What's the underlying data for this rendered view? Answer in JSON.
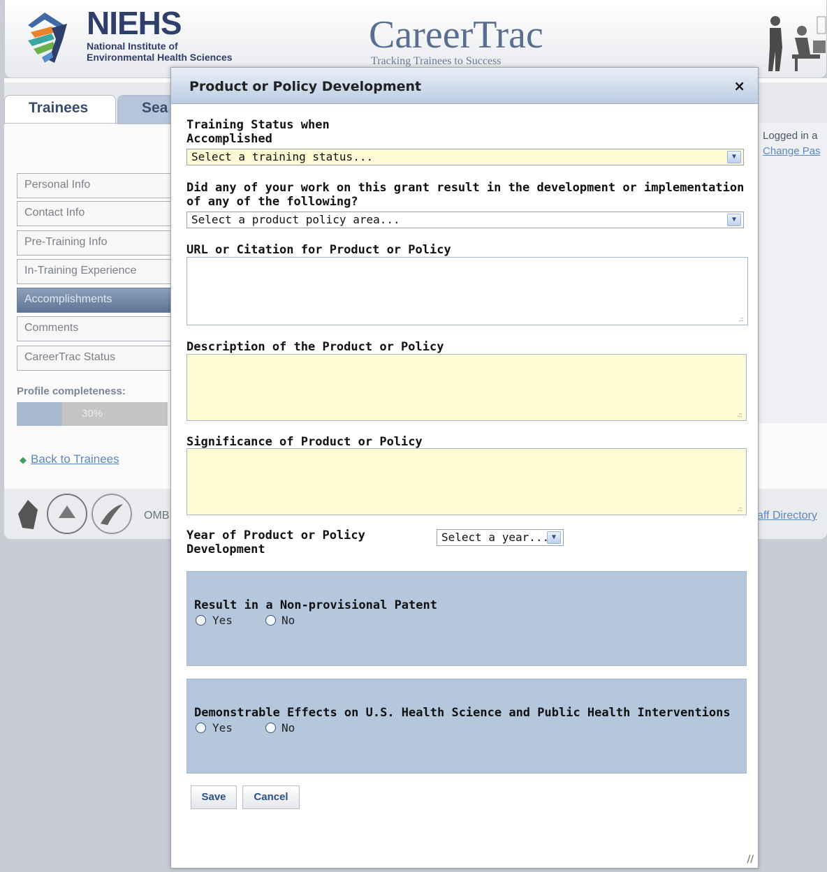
{
  "header": {
    "org_abbrev": "NIEHS",
    "org_line1": "National Institute of",
    "org_line2": "Environmental Health Sciences",
    "app_title": "CareerTrac",
    "app_tagline": "Tracking Trainees to Success"
  },
  "tabs": [
    {
      "label": "Trainees",
      "active": true
    },
    {
      "label": "Sea",
      "active": false
    }
  ],
  "sidebar": {
    "items": [
      {
        "label": "Personal Info",
        "active": false
      },
      {
        "label": "Contact Info",
        "active": false
      },
      {
        "label": "Pre-Training Info",
        "active": false
      },
      {
        "label": "In-Training Experience",
        "active": false
      },
      {
        "label": "Accomplishments",
        "active": true
      },
      {
        "label": "Comments",
        "active": false
      },
      {
        "label": "CareerTrac Status",
        "active": false
      }
    ],
    "profile_label": "Profile completeness:",
    "profile_percent": 30,
    "profile_text": "30%",
    "back_link": "Back to Trainees"
  },
  "user_panel": {
    "logged_in": "Logged in a",
    "change_password": "Change Pas"
  },
  "footer": {
    "omb": "OMB",
    "staff_directory": "aff Directory"
  },
  "dialog": {
    "title": "Product or Policy Development",
    "close_glyph": "×",
    "training_status": {
      "label_line1": "Training Status when",
      "label_line2": "Accomplished",
      "placeholder": "Select a training status..."
    },
    "product_area": {
      "label_line1": "Did any of your work on this grant result in the development or implementation",
      "label_line2": "of any of the following?",
      "placeholder": "Select a product policy area..."
    },
    "url_label": "URL or Citation for Product or Policy",
    "description_label": "Description of the Product or Policy",
    "significance_label": "Significance of Product or Policy",
    "year": {
      "label_line1": "Year of Product or Policy",
      "label_line2": "Development",
      "placeholder": "Select a year..."
    },
    "patent": {
      "label": "Result in a Non-provisional Patent",
      "yes": "Yes",
      "no": "No"
    },
    "effects": {
      "label": "Demonstrable Effects on U.S. Health Science and Public Health Interventions",
      "yes": "Yes",
      "no": "No"
    },
    "save_label": "Save",
    "cancel_label": "Cancel"
  },
  "colors": {
    "accent": "#5e7597",
    "field_yellow": "#fefad4",
    "radio_panel": "#b4c7dd",
    "link": "#5b88c0"
  }
}
